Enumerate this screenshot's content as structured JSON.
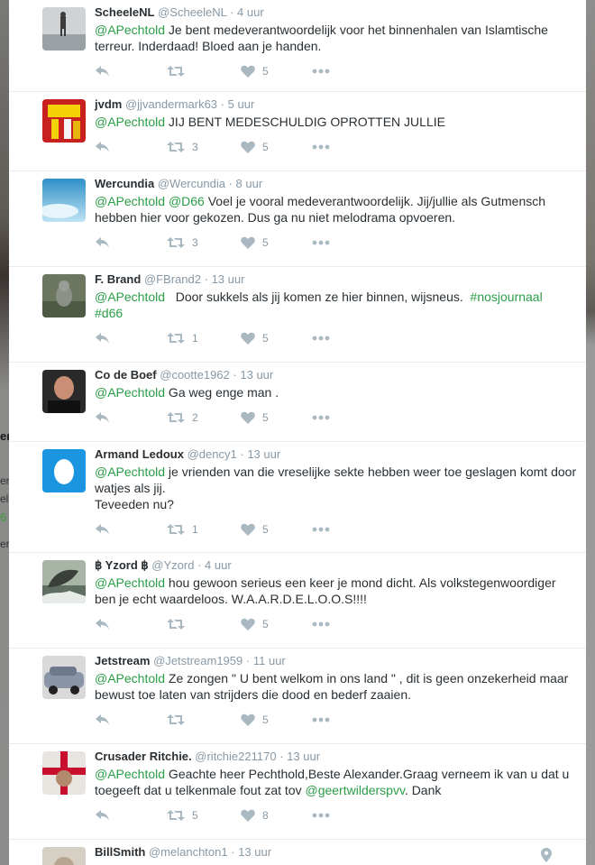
{
  "background_fragments": {
    "name_cut": "er",
    "line1": "er",
    "line2": "el",
    "link_cut": "6",
    "line3": "er"
  },
  "colors": {
    "mention": "#2a9d47",
    "icon_gray": "#aab8c2",
    "text": "#292f33",
    "meta": "#8899a6"
  },
  "tweets": [
    {
      "name": "ScheeleNL",
      "handle": "@ScheeleNL",
      "dot": "·",
      "time": "4 uur",
      "text_mention": "@APechtold",
      "text_body": " Je bent medeverantwoordelijk voor het binnenhalen van Islamtische terreur. Inderdaad! Bloed aan je handen.",
      "retweets": "",
      "likes": "5",
      "avatar": "person-on-beach-photo"
    },
    {
      "name": "jvdm",
      "handle": "@jjvandermark63",
      "dot": "·",
      "time": "5 uur",
      "text_mention": "@APechtold",
      "text_body": " JIJ BENT MEDESCHULDIG OPROTTEN JULLIE",
      "retweets": "3",
      "likes": "5",
      "avatar": "red-yellow-sign-photo"
    },
    {
      "name": "Wercundia",
      "handle": "@Wercundia",
      "dot": "·",
      "time": "8 uur",
      "text_mention": "@APechtold",
      "text_mention2": "@D66",
      "text_body": " Voel je vooral medeverantwoordelijk. Jij/jullie als Gutmensch hebben hier voor gekozen. Dus ga nu niet melodrama opvoeren.",
      "retweets": "3",
      "likes": "5",
      "avatar": "sky-photo"
    },
    {
      "name": "F. Brand",
      "handle": "@FBrand2",
      "dot": "·",
      "time": "13 uur",
      "text_mention": "@APechtold",
      "text_body": "   Door sukkels als jij komen ze hier binnen, wijsneus.  ",
      "hashtag1": "#nosjournaal",
      "hashtag2": "#d66",
      "retweets": "1",
      "likes": "5",
      "avatar": "cat-photo"
    },
    {
      "name": "Co de Boef",
      "handle": "@cootte1962",
      "dot": "·",
      "time": "13 uur",
      "text_mention": "@APechtold",
      "text_body": " Ga weg enge man .",
      "retweets": "2",
      "likes": "5",
      "avatar": "bald-man-photo"
    },
    {
      "name": "Armand Ledoux",
      "handle": "@dency1",
      "dot": "·",
      "time": "13 uur",
      "text_mention": "@APechtold",
      "text_body": " je vrienden van die vreselijke sekte hebben weer toe geslagen komt door watjes als jij.",
      "text_line2": "Teveeden nu?",
      "retweets": "1",
      "likes": "5",
      "avatar": "default-egg-avatar"
    },
    {
      "name": "฿ Yzord ฿",
      "handle": "@Yzord",
      "dot": "·",
      "time": "4 uur",
      "text_mention": "@APechtold",
      "text_body": " hou gewoon serieus een keer je mond dicht. Als volkstegenwoordiger ben je echt waardeloos. W.A.A.R.D.E.L.O.O.S!!!!",
      "retweets": "",
      "likes": "5",
      "avatar": "whale-painting"
    },
    {
      "name": "Jetstream",
      "handle": "@Jetstream1959",
      "dot": "·",
      "time": "11 uur",
      "text_mention": "@APechtold",
      "text_body": " Ze zongen \" U bent welkom in ons land \" , dit is geen onzekerheid maar bewust toe laten van strijders die dood en bederf zaaien.",
      "retweets": "",
      "likes": "5",
      "avatar": "car-photo"
    },
    {
      "name": "Crusader Ritchie.",
      "handle": "@ritchie221170",
      "dot": "·",
      "time": "13 uur",
      "text_mention": "@APechtold",
      "text_body": " Geachte heer Pechthold,Beste Alexander.Graag verneem ik van u dat u toegeeft dat u telkenmale fout zat tov ",
      "text_mention2": "@geertwilderspvv",
      "text_tail": ". Dank",
      "retweets": "5",
      "likes": "8",
      "avatar": "crusader-flag-photo"
    },
    {
      "name": "BillSmith",
      "handle": "@melanchton1",
      "dot": "·",
      "time": "13 uur",
      "avatar": "man-portrait-photo"
    }
  ]
}
